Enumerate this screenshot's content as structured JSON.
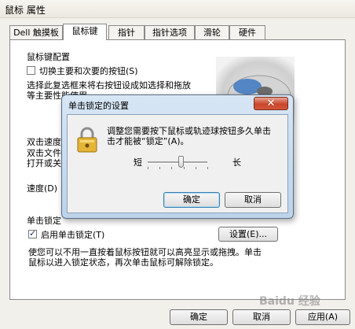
{
  "window": {
    "title": "鼠标 属性",
    "tabs": [
      {
        "label": "Dell 触摸板"
      },
      {
        "label": "鼠标键"
      },
      {
        "label": "指针"
      },
      {
        "label": "指针选项"
      },
      {
        "label": "滑轮"
      },
      {
        "label": "硬件"
      }
    ],
    "active_tab": "鼠标键"
  },
  "button_config": {
    "title": "鼠标键配置",
    "switch_label": "切换主要和次要的按钮(S)",
    "switch_checked": false,
    "desc_line1": "选择此复选框来将右按钮设成如选择和拖放",
    "desc_line2": "等主要性能使用"
  },
  "double_click": {
    "title_partial": "双击速度",
    "line1_partial": "双击文件",
    "line2_partial": "打开或关",
    "speed_label": "速度(D)"
  },
  "click_lock": {
    "title_partial": "单击锁定",
    "enable_label": "启用单击锁定(T)",
    "enable_checked": true,
    "settings_button": "设置(E)...",
    "desc_line1": "使您可以不用一直按着鼠标按钮就可以高亮显示或拖拽。单击",
    "desc_line2": "鼠标以进入锁定状态，再次单击鼠标可解除锁定。"
  },
  "footer": {
    "ok": "确定",
    "cancel": "取消",
    "apply": "应用(A)"
  },
  "dialog": {
    "title": "单击锁定的设置",
    "message_line1": "调整您需要按下鼠标或轨迹球按钮多久单击",
    "message_line2": "击才能被“锁定”(A)。",
    "slider_short": "短",
    "slider_long": "长",
    "slider_value": 0.55,
    "ok": "确定",
    "cancel": "取消",
    "icon": "padlock-icon"
  },
  "watermark": "Baidu 经验"
}
